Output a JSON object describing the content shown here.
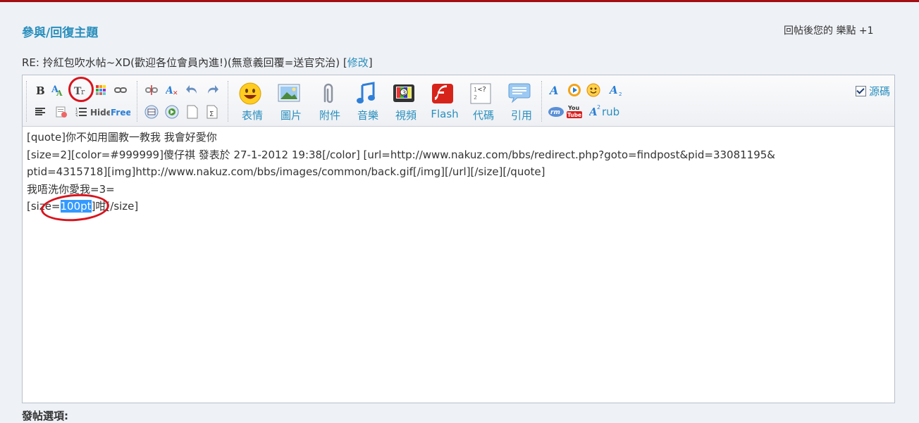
{
  "header": {
    "title": "參與/回復主題",
    "credits": "回帖後您的 樂點 +1"
  },
  "subject": {
    "text": "RE: 拎紅包吹水帖~XD(歡迎各位會員內進!)(無意義回覆=送官究治)",
    "bracket_open": "[",
    "edit_link": "修改",
    "bracket_close": "]"
  },
  "toolbar": {
    "small_icons": [
      "bold-icon",
      "font-color-icon",
      "font-size-icon",
      "background-color-icon",
      "link-icon",
      "unlink-icon",
      "remove-format-icon",
      "undo-icon",
      "redo-icon",
      "align-icon",
      "attachment-list-icon",
      "list-icon",
      "hide-icon",
      "free-icon",
      "insert-table-icon",
      "insert-media-icon",
      "page-icon",
      "formula-icon"
    ],
    "hide_label": "Hide",
    "free_label": "Free",
    "big_buttons": [
      {
        "label": "表情",
        "icon": "smiley-icon"
      },
      {
        "label": "圖片",
        "icon": "image-icon"
      },
      {
        "label": "附件",
        "icon": "paperclip-icon"
      },
      {
        "label": "音樂",
        "icon": "music-icon"
      },
      {
        "label": "視頻",
        "icon": "video-icon"
      },
      {
        "label": "Flash",
        "icon": "flash-icon"
      },
      {
        "label": "代碼",
        "icon": "code-icon"
      },
      {
        "label": "引用",
        "icon": "quote-icon"
      }
    ],
    "ext_labels": {
      "rm": "rm",
      "youtube_top": "You",
      "youtube_bottom": "Tube",
      "rub": "rub",
      "sup": "2"
    },
    "source_mode_label": "源碼",
    "source_mode_checked": true
  },
  "editor": {
    "line1": "[quote]你不如用圖教一教我 我會好愛你",
    "line2": "[size=2][color=#999999]傻仔祺 發表於 27-1-2012 19:38[/color] [url=http://www.nakuz.com/bbs/redirect.php?goto=findpost&pid=33081195&",
    "line3": "ptid=4315718][img]http://www.nakuz.com/bbs/images/common/back.gif[/img][/url][/size][/quote]",
    "line4": "我唔洗你愛我=3=",
    "line5_pre": "[size=",
    "line5_sel": "100pt",
    "line5_post": "]咁[/size]"
  },
  "footer": {
    "label": "發帖選項:"
  },
  "colors": {
    "accent": "#2a8fbd",
    "highlight": "#d8141d",
    "selection": "#3399ff"
  }
}
